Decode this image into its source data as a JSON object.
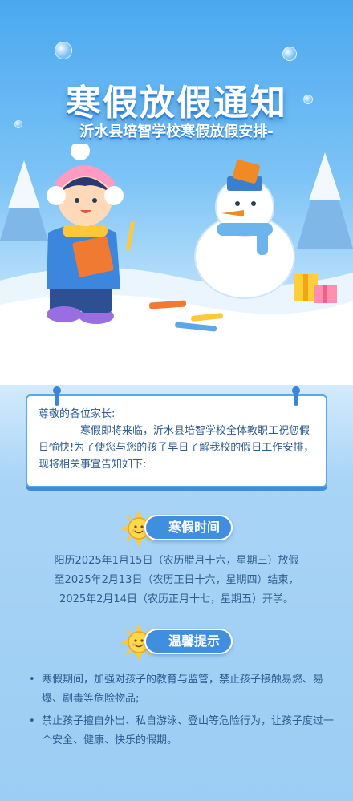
{
  "header": {
    "title": "寒假放假通知",
    "subtitle": "沂水县培智学校寒假放假安排-"
  },
  "notice": {
    "greeting": "尊敬的各位家长:",
    "intro": "寒假即将来临，沂水县培智学校全体教职工祝您假日愉快!为了使您与您的孩子早日了解我校的假日工作安排，现将相关事宜告知如下:"
  },
  "sections": {
    "time": {
      "title": "寒假时间",
      "lines": [
        "阳历2025年1月15日（农历腊月十六，星期三）放假",
        "至2025年2月13日（农历正日十六，星期四）结束，",
        "2025年2月14日（农历正月十七，星期五）开学。"
      ]
    },
    "tips": {
      "title": "温馨提示",
      "items": [
        "寒假期间，加强对孩子的教育与监管，禁止孩子接触易燃、易爆、剧毒等危险物品;",
        "禁止孩子擅自外出、私自游泳、登山等危险行为，让孩子度过一个安全、健康、快乐的假期。"
      ]
    }
  },
  "colors": {
    "accent": "#3f8ee0",
    "text": "#2e5d8f",
    "sky": "#4aa8ef",
    "sun": "#ffc83a"
  },
  "icons": [
    "sun-icon",
    "pin-icon",
    "snowman-illustration",
    "child-illustration",
    "gift-icon"
  ]
}
